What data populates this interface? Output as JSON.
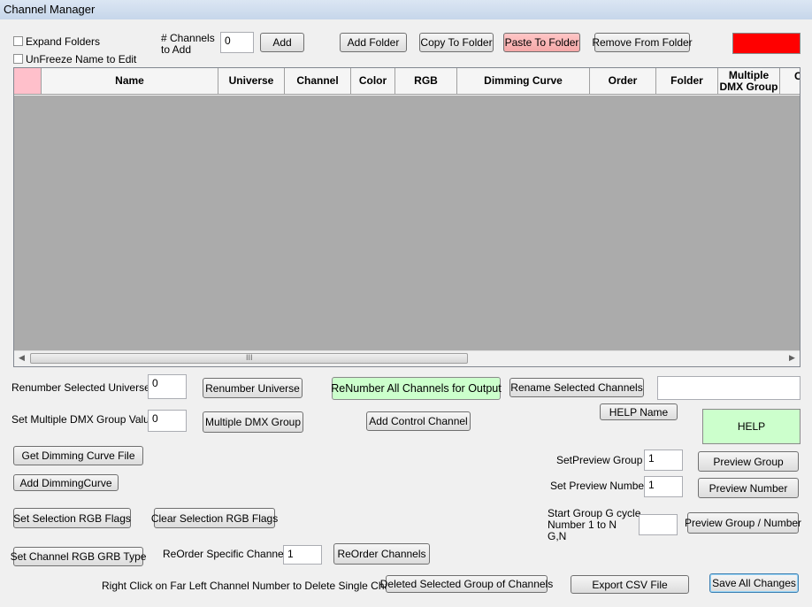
{
  "window": {
    "title": "Channel Manager"
  },
  "top": {
    "expand_folders": "Expand Folders",
    "unfreeze_name": "UnFreeze Name to Edit",
    "channels_to_add_label_1": "# Channels",
    "channels_to_add_label_2": "to Add",
    "channels_to_add_value": "0",
    "add": "Add",
    "add_folder": "Add Folder",
    "copy_to_folder": "Copy To Folder",
    "paste_to_folder": "Paste To Folder",
    "remove_from_folder": "Remove From Folder",
    "color_indicator": "#ff0000"
  },
  "grid": {
    "columns": {
      "name": "Name",
      "universe": "Universe",
      "channel": "Channel",
      "color": "Color",
      "rgb": "RGB",
      "dimming_curve": "Dimming Curve",
      "order": "Order",
      "folder": "Folder",
      "multiple_dmx_1": "Multiple",
      "multiple_dmx_2": "DMX Group",
      "partial": "C"
    },
    "scroll_grip": "III"
  },
  "controls": {
    "renumber_selected_universe": "Renumber Selected Universe",
    "renumber_value": "0",
    "renumber_universe": "Renumber Universe",
    "renumber_all": "ReNumber All Channels for Output",
    "rename_selected": "Rename Selected Channels",
    "rename_value": "",
    "set_multiple_dmx_label": "Set Multiple DMX Group Value",
    "multiple_dmx_value": "0",
    "multiple_dmx_group": "Multiple DMX Group",
    "add_control_channel": "Add Control Channel",
    "help_name": "HELP Name",
    "help": "HELP",
    "get_dimming_curve_file": "Get Dimming Curve File",
    "add_dimming_curve": "Add DimmingCurve",
    "set_preview_group_label": "SetPreview Group",
    "set_preview_group_value": "1",
    "preview_group": "Preview Group",
    "set_preview_number_label": "Set Preview Number",
    "set_preview_number_value": "1",
    "preview_number": "Preview Number",
    "set_selection_rgb": "Set Selection RGB Flags",
    "clear_selection_rgb": "Clear Selection RGB Flags",
    "start_group_1": "Start Group G cycle",
    "start_group_2": "Number 1 to N",
    "start_group_3": "G,N",
    "start_group_value": "",
    "preview_group_number": "Preview Group / Number",
    "set_channel_rgb_grb": "Set Channel RGB GRB Type",
    "reorder_specific_label": "ReOrder Specific Channels",
    "reorder_value": "1",
    "reorder_channels": "ReOrder Channels",
    "right_click_hint": "Right Click on Far Left Channel Number to Delete Single Channel",
    "delete_selected_group": "Deleted Selected Group of Channels",
    "export_csv": "Export CSV File",
    "save_all_changes": "Save All Changes"
  }
}
